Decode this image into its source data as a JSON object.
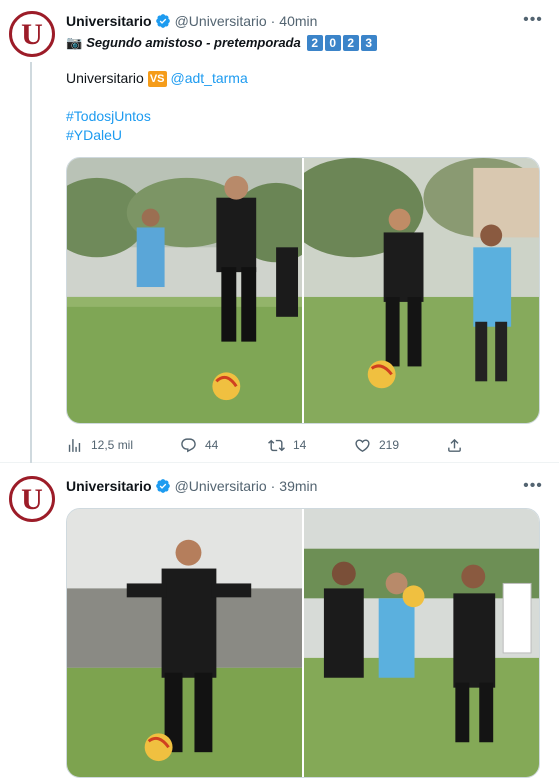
{
  "tweets": [
    {
      "author_name": "Universitario",
      "handle": "@Universitario",
      "separator": "·",
      "time": "40min",
      "avatar_letter": "U",
      "line1_camera": "📷",
      "line1_text": "Segundo amistoso - pretemporada",
      "year_digits": [
        "2",
        "0",
        "2",
        "3"
      ],
      "line2_prefix": "Universitario",
      "vs_badge": "VS",
      "mention": "@adt_tarma",
      "hashtags": [
        "#TodosjUntos",
        "#YDaleU"
      ],
      "actions": {
        "views": "12,5 mil",
        "replies": "44",
        "retweets": "14",
        "likes": "219"
      }
    },
    {
      "author_name": "Universitario",
      "handle": "@Universitario",
      "separator": "·",
      "time": "39min",
      "avatar_letter": "U"
    }
  ],
  "colors": {
    "link": "#1d9bf0",
    "verified": "#1d9bf0",
    "brand_red": "#9c1c28",
    "muted": "#536471",
    "year_badge": "#3b84c9",
    "vs_badge": "#f59c1a"
  },
  "icons": [
    "more-icon",
    "verified-icon",
    "views-icon",
    "reply-icon",
    "retweet-icon",
    "like-icon",
    "share-icon"
  ]
}
